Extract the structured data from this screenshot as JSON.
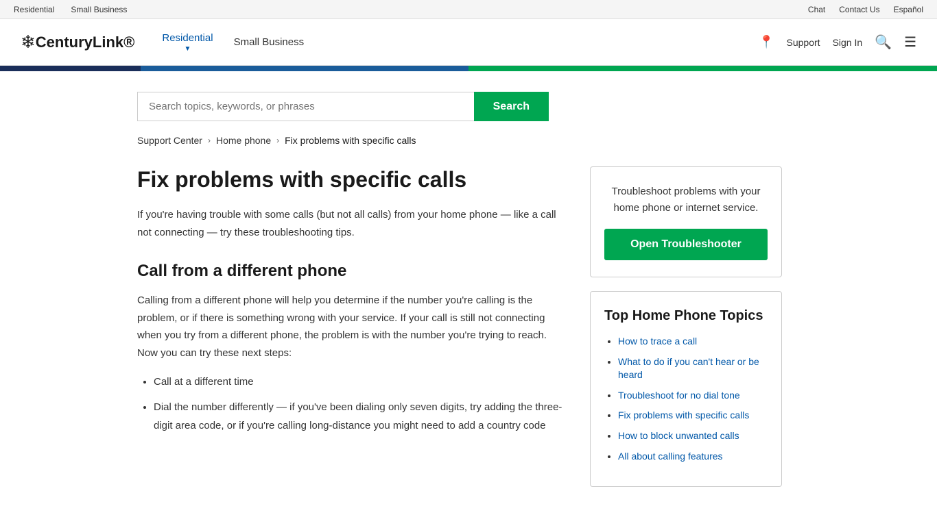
{
  "utility_bar": {
    "left_links": [
      {
        "label": "Residential",
        "url": "#"
      },
      {
        "label": "Small Business",
        "url": "#"
      }
    ],
    "right_links": [
      {
        "label": "Chat",
        "url": "#"
      },
      {
        "label": "Contact Us",
        "url": "#"
      },
      {
        "label": "Español",
        "url": "#"
      }
    ]
  },
  "nav": {
    "logo_text": "CenturyLink®",
    "links": [
      {
        "label": "Residential",
        "active": true
      },
      {
        "label": "Small Business",
        "active": false
      }
    ],
    "right_links": [
      {
        "label": "Support"
      },
      {
        "label": "Sign In"
      }
    ]
  },
  "search": {
    "placeholder": "Search topics, keywords, or phrases",
    "button_label": "Search"
  },
  "breadcrumb": {
    "items": [
      {
        "label": "Support Center",
        "url": "#"
      },
      {
        "label": "Home phone",
        "url": "#"
      },
      {
        "label": "Fix problems with specific calls",
        "current": true
      }
    ]
  },
  "article": {
    "title": "Fix problems with specific calls",
    "intro": "If you're having trouble with some calls (but not all calls) from your home phone — like a call not connecting — try these troubleshooting tips.",
    "section1_title": "Call from a different phone",
    "section1_body": "Calling from a different phone will help you determine if the number you're calling is the problem, or if there is something wrong with your service. If your call is still not connecting when you try from a different phone, the problem is with the number you're trying to reach. Now you can try these next steps:",
    "bullet_items": [
      "Call at a different time",
      "Dial the number differently — if you've been dialing only seven digits, try adding the three-digit area code, or if you're calling long-distance you might need to add a country code"
    ]
  },
  "sidebar": {
    "troubleshooter_card": {
      "description": "Troubleshoot problems with your home phone or internet service.",
      "button_label": "Open Troubleshooter"
    },
    "topics_card": {
      "title": "Top Home Phone Topics",
      "links": [
        {
          "label": "How to trace a call",
          "url": "#"
        },
        {
          "label": "What to do if you can't hear or be heard",
          "url": "#"
        },
        {
          "label": "Troubleshoot for no dial tone",
          "url": "#"
        },
        {
          "label": "Fix problems with specific calls",
          "url": "#"
        },
        {
          "label": "How to block unwanted calls",
          "url": "#"
        },
        {
          "label": "All about calling features",
          "url": "#"
        }
      ]
    }
  }
}
